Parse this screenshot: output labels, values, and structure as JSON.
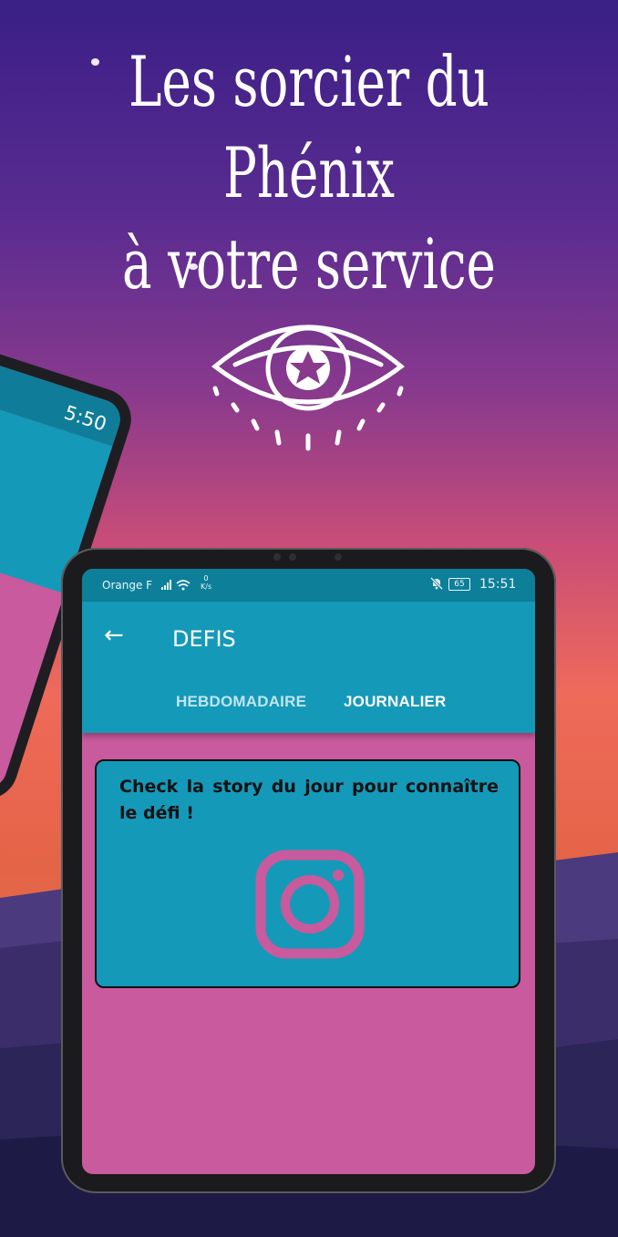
{
  "headline": {
    "line1": "Les sorcier du Phénix",
    "line2": "à votre service"
  },
  "icons": {
    "emblem": "all-seeing-eye-pentagram-icon",
    "back": "arrow-left-icon",
    "social": "instagram-icon",
    "signal": "cellular-signal-icon",
    "wifi": "wifi-icon",
    "mute": "notifications-off-icon",
    "battery": "battery-icon"
  },
  "left_device": {
    "time": "5:50"
  },
  "statusbar": {
    "carrier": "Orange F",
    "signal_glyph": ".ıll",
    "speed_value": "0",
    "speed_unit": "K/s",
    "battery": "65",
    "time": "15:51"
  },
  "appbar": {
    "back_glyph": "←",
    "title": "DEFIS"
  },
  "tabs": [
    {
      "label": "HEBDOMADAIRE",
      "selected": false
    },
    {
      "label": "JOURNALIER",
      "selected": true
    }
  ],
  "card": {
    "text": "Check la story du jour pour connaître le défi !"
  },
  "colors": {
    "app_bar": "#1599b9",
    "status_bar": "#0e7f99",
    "content_background": "#c95a9d",
    "instagram_icon": "#c95a9d"
  }
}
